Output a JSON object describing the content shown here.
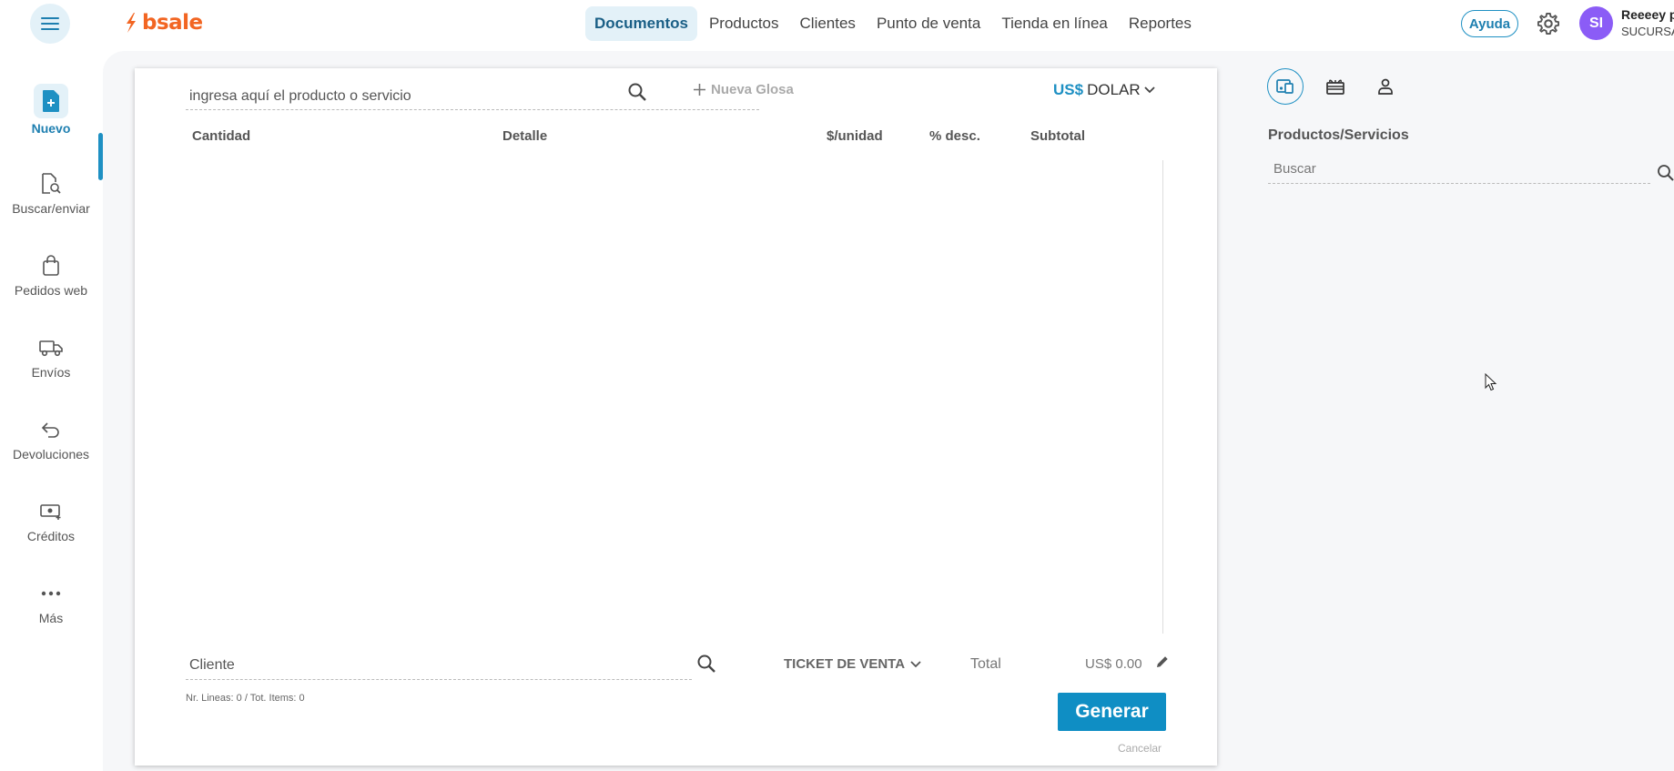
{
  "header": {
    "logo_text": "bsale",
    "nav": [
      "Documentos",
      "Productos",
      "Clientes",
      "Punto de venta",
      "Tienda en línea",
      "Reportes"
    ],
    "help_label": "Ayuda",
    "avatar_initials": "SI",
    "user_name": "Reeeey p",
    "user_branch": "SUCURSA"
  },
  "sidebar": {
    "items": [
      {
        "label": "Nuevo",
        "icon": "new-document-icon"
      },
      {
        "label": "Buscar/enviar",
        "icon": "document-search-icon"
      },
      {
        "label": "Pedidos web",
        "icon": "shopping-bag-icon"
      },
      {
        "label": "Envíos",
        "icon": "truck-icon"
      },
      {
        "label": "Devoluciones",
        "icon": "return-arrow-icon"
      },
      {
        "label": "Créditos",
        "icon": "money-icon"
      },
      {
        "label": "Más",
        "icon": "more-dots-icon"
      }
    ]
  },
  "document": {
    "product_search_placeholder": "ingresa aquí el producto o servicio",
    "new_glosa": "Nueva Glosa",
    "currency_symbol": "US$",
    "currency_name": "DOLAR",
    "columns": [
      "Cantidad",
      "Detalle",
      "$/unidad",
      "% desc.",
      "Subtotal"
    ],
    "client_placeholder": "Cliente",
    "doc_type": "TICKET DE VENTA",
    "total_label": "Total",
    "total_value": "US$ 0.00",
    "counts": "Nr. Lineas: 0 / Tot. Items: 0",
    "generate_label": "Generar",
    "cancel_label": "Cancelar"
  },
  "right_panel": {
    "tabs": [
      "products-tab-icon",
      "gift-tab-icon",
      "client-tab-icon"
    ],
    "title": "Productos/Servicios",
    "search_placeholder": "Buscar"
  },
  "colors": {
    "brand_orange": "#f26522",
    "accent_blue": "#1e90c3",
    "button_blue": "#0f8ec4",
    "avatar_purple": "#8b5cf6"
  }
}
